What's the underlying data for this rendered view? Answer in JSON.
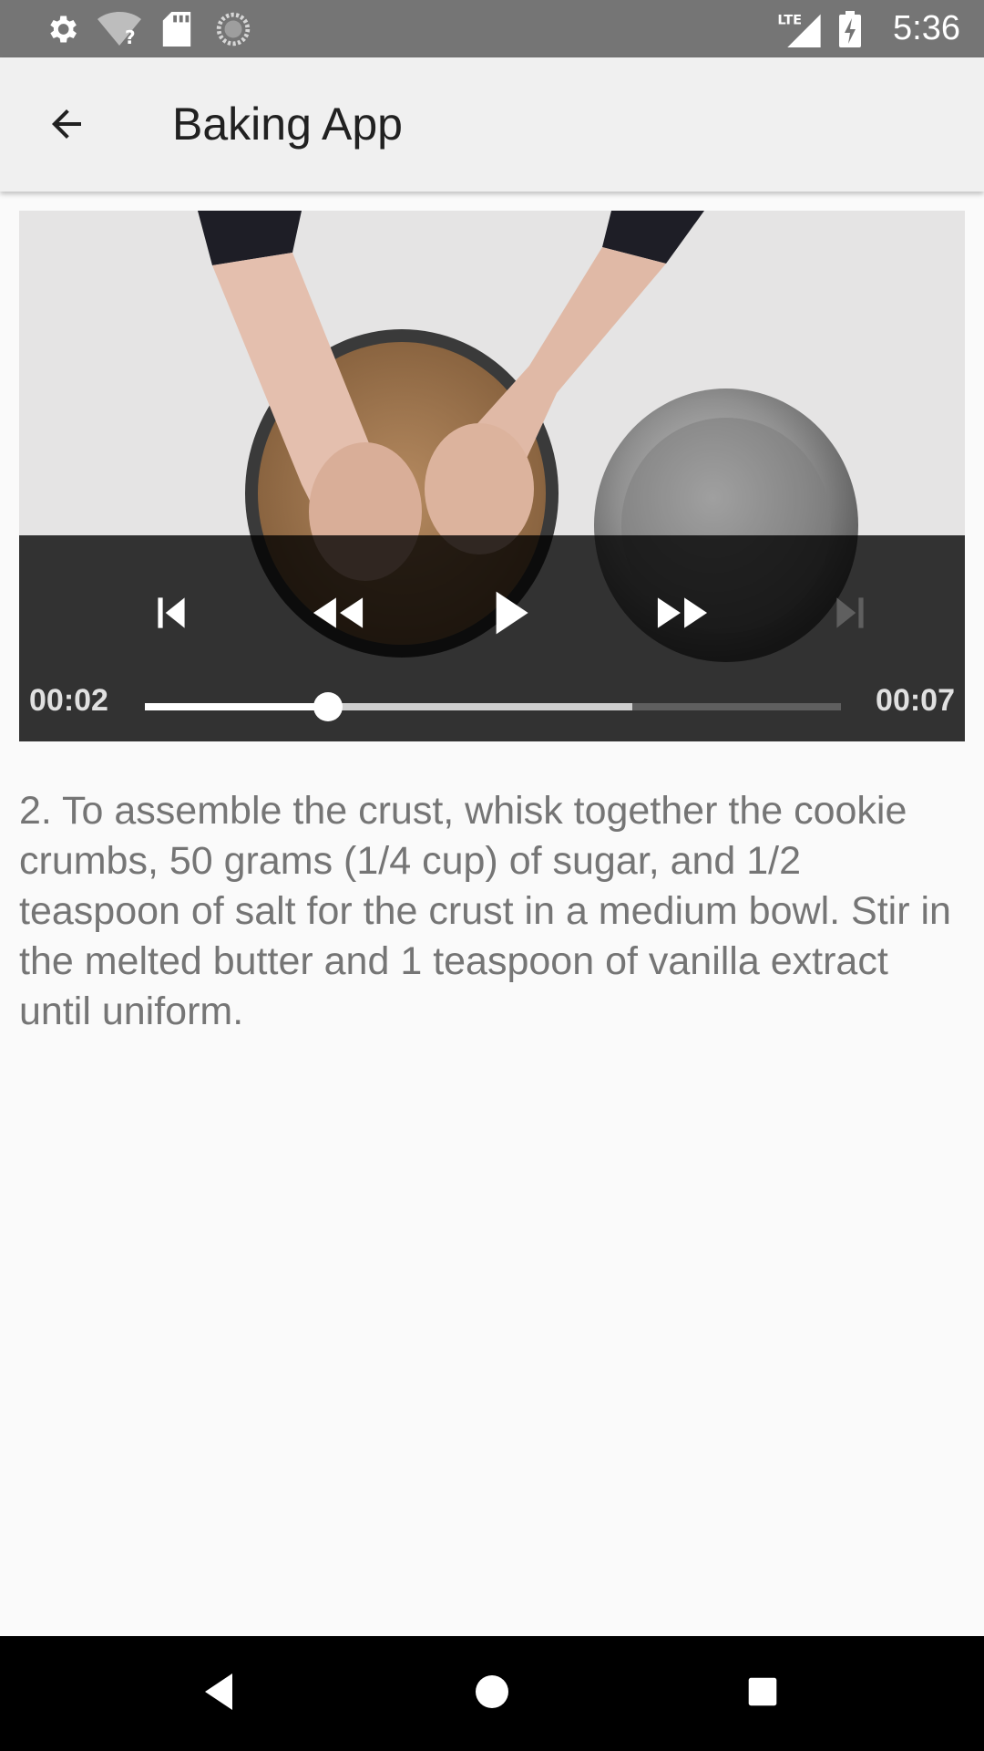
{
  "status_bar": {
    "time": "5:36",
    "network_label": "LTE",
    "icons": [
      "settings-icon",
      "wifi-unknown-icon",
      "sd-card-icon",
      "sync-icon",
      "signal-icon",
      "battery-charging-icon"
    ]
  },
  "toolbar": {
    "title": "Baking App",
    "back_icon": "arrow-back-icon"
  },
  "player": {
    "position": "00:02",
    "duration": "00:07",
    "played_fraction": 0.263,
    "buffered_fraction": 0.7,
    "controls": [
      "skip-previous-icon",
      "rewind-icon",
      "play-icon",
      "fast-forward-icon",
      "skip-next-icon"
    ]
  },
  "step": {
    "description": "2. To assemble the crust, whisk together the cookie crumbs, 50 grams (1/4 cup) of sugar, and 1/2 teaspoon of salt for the crust in a medium bowl. Stir in the melted butter and 1 teaspoon of vanilla extract until uniform."
  },
  "nav_bar": {
    "buttons": [
      "back-triangle-icon",
      "home-circle-icon",
      "recents-square-icon"
    ]
  },
  "colors": {
    "status_bar": "#757575",
    "toolbar": "#f0f0f0",
    "background": "#fafafa",
    "step_text": "#757575"
  }
}
